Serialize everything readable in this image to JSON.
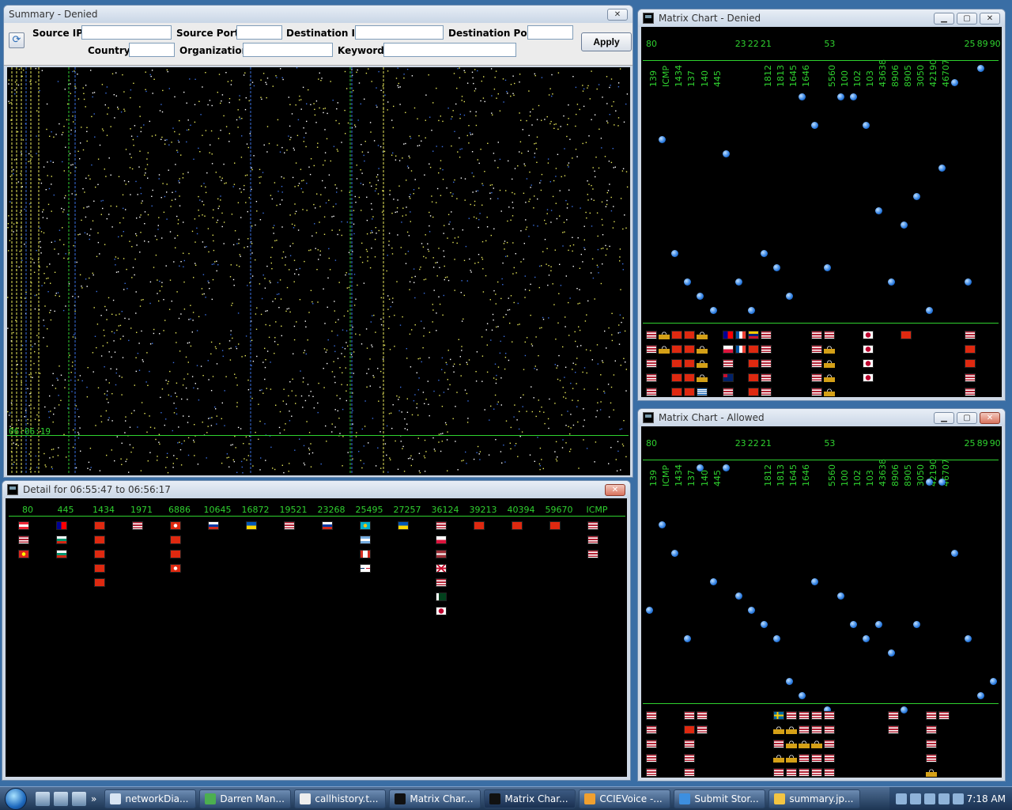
{
  "summary": {
    "title": "Summary - Denied",
    "filters": {
      "source_ip_label": "Source IP:",
      "source_port_label": "Source Port:",
      "destination_ip_label": "Destination IP:",
      "destination_port_label": "Destination Port:",
      "country_label": "Country:",
      "organization_label": "Organization:",
      "keyword_label": "Keyword:",
      "source_ip": "",
      "source_port": "",
      "destination_ip": "",
      "destination_port": "",
      "country": "",
      "organization": "",
      "keyword": ""
    },
    "apply_label": "Apply",
    "timestamp": "06:06:19"
  },
  "detail": {
    "title": "Detail for 06:55:47 to 06:56:17",
    "columns": [
      {
        "port": "80",
        "flags": [
          "at",
          "us",
          "vn"
        ]
      },
      {
        "port": "445",
        "flags": [
          "tw",
          "bg",
          "bg"
        ]
      },
      {
        "port": "1434",
        "flags": [
          "cn",
          "cn",
          "cn",
          "cn",
          "cn"
        ]
      },
      {
        "port": "1971",
        "flags": [
          "us"
        ]
      },
      {
        "port": "6886",
        "flags": [
          "hk",
          "cn",
          "cn",
          "hk"
        ]
      },
      {
        "port": "10645",
        "flags": [
          "ru"
        ]
      },
      {
        "port": "16872",
        "flags": [
          "ua"
        ]
      },
      {
        "port": "19521",
        "flags": [
          "us"
        ]
      },
      {
        "port": "23268",
        "flags": [
          "ru"
        ]
      },
      {
        "port": "25495",
        "flags": [
          "kz",
          "ar",
          "ca",
          "do"
        ]
      },
      {
        "port": "27257",
        "flags": [
          "ua"
        ]
      },
      {
        "port": "36124",
        "flags": [
          "us",
          "pl",
          "lv",
          "gb",
          "us",
          "pk",
          "jp"
        ]
      },
      {
        "port": "39213",
        "flags": [
          "cn"
        ]
      },
      {
        "port": "40394",
        "flags": [
          "cn"
        ]
      },
      {
        "port": "59670",
        "flags": [
          "cn"
        ]
      },
      {
        "port": "ICMP",
        "flags": [
          "us",
          "us",
          "us"
        ]
      }
    ]
  },
  "matrix_denied": {
    "title": "Matrix Chart - Denied",
    "ports": [
      "80",
      "139",
      "ICMP",
      "1434",
      "137",
      "140",
      "445",
      "23",
      "22",
      "21",
      "1812",
      "1813",
      "1645",
      "1646",
      "53",
      "5560",
      "100",
      "102",
      "103",
      "43638",
      "8906",
      "8905",
      "3050",
      "42190",
      "46707",
      "25",
      "89",
      "90"
    ]
  },
  "matrix_allowed": {
    "title": "Matrix Chart - Allowed",
    "ports": [
      "80",
      "139",
      "ICMP",
      "1434",
      "137",
      "140",
      "445",
      "23",
      "22",
      "21",
      "1812",
      "1813",
      "1645",
      "1646",
      "53",
      "5560",
      "100",
      "102",
      "103",
      "43638",
      "8906",
      "8905",
      "3050",
      "42190",
      "46707",
      "25",
      "89",
      "90"
    ]
  },
  "taskbar": {
    "items": [
      {
        "label": "networkDia...",
        "icon_color": "#d8e4f2"
      },
      {
        "label": "Darren Man...",
        "icon_color": "#4caf50"
      },
      {
        "label": "callhistory.t...",
        "icon_color": "#eeeeee"
      },
      {
        "label": "Matrix Char...",
        "icon_color": "#111111"
      },
      {
        "label": "Matrix Char...",
        "icon_color": "#111111"
      },
      {
        "label": "CCIEVoice -...",
        "icon_color": "#f0a030"
      },
      {
        "label": "Submit Stor...",
        "icon_color": "#3d8fe0"
      },
      {
        "label": "summary.jp...",
        "icon_color": "#f4c542"
      }
    ],
    "clock": "7:18 AM"
  },
  "colors": {
    "accent_green": "#2fd12f",
    "dot_blue": "#2a7be0",
    "yellow_points": "#e8e85a"
  }
}
